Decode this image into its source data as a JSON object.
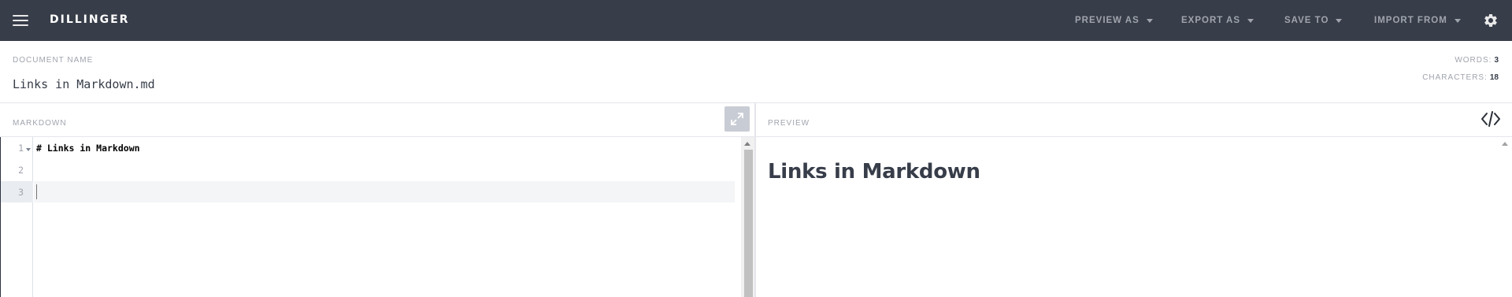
{
  "navbar": {
    "brand": "DILLINGER",
    "menu_icon": "hamburger-menu-icon",
    "items": [
      {
        "label": "PREVIEW AS"
      },
      {
        "label": "EXPORT AS"
      },
      {
        "label": "SAVE TO"
      },
      {
        "label": "IMPORT FROM"
      }
    ],
    "settings_icon": "gear-icon",
    "background_color": "#373d49"
  },
  "document": {
    "label": "DOCUMENT NAME",
    "name": "Links in Markdown.md",
    "words_label": "WORDS:",
    "words_value": "3",
    "characters_label": "CHARACTERS:",
    "characters_value": "18"
  },
  "editor": {
    "label": "MARKDOWN",
    "expand_icon": "expand-icon",
    "line_numbers": [
      "1",
      "2",
      "3"
    ],
    "lines": [
      "# Links in Markdown",
      "",
      ""
    ],
    "active_line": "3"
  },
  "preview": {
    "label": "PREVIEW",
    "toggle_icon": "code-icon",
    "heading": "Links in Markdown"
  }
}
